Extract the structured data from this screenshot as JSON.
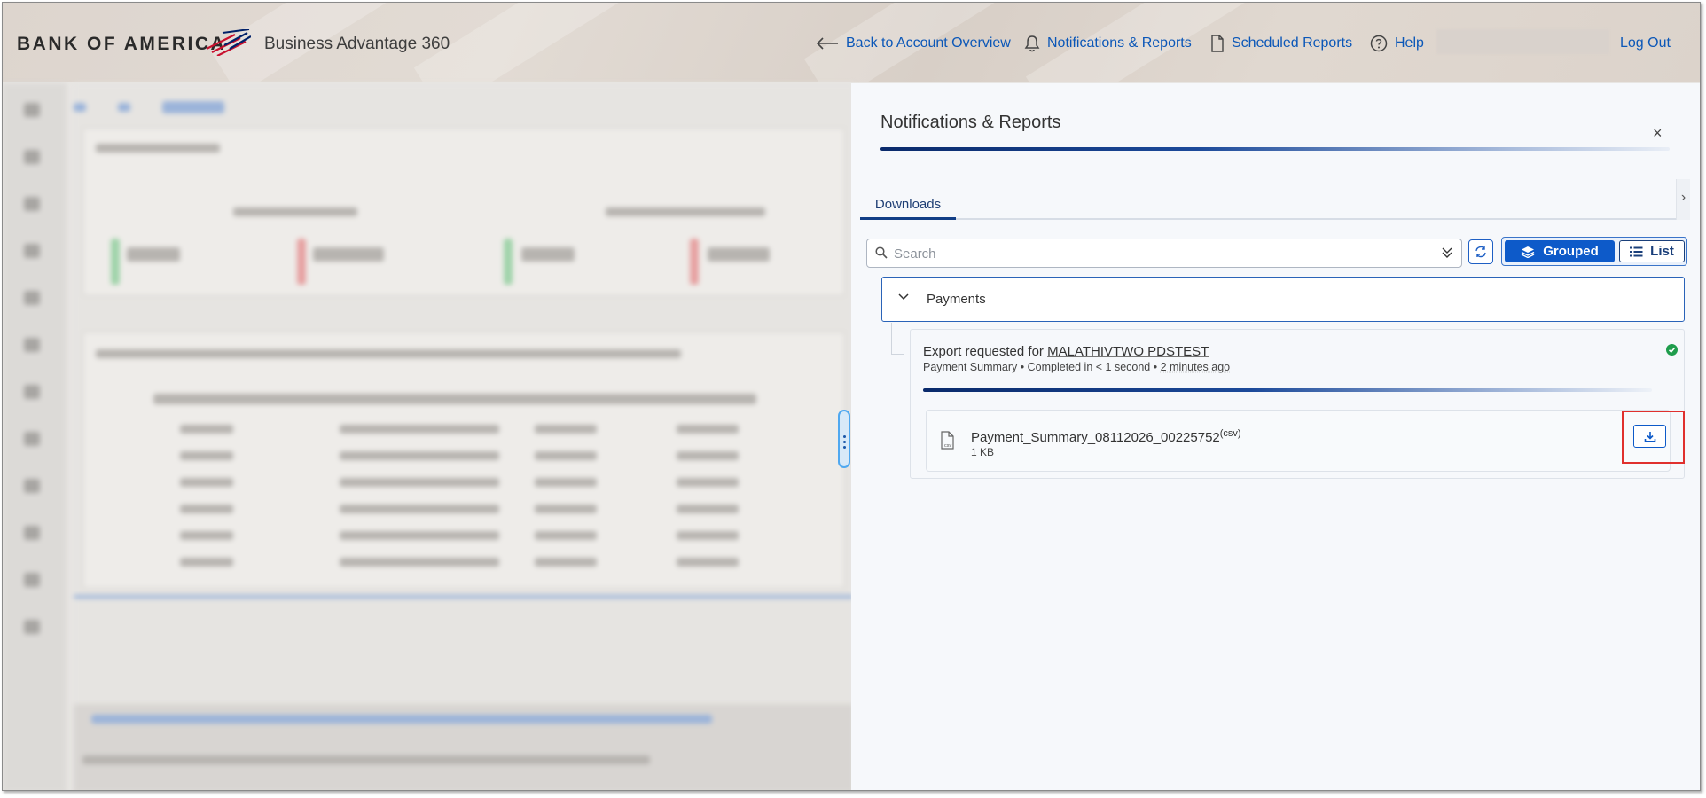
{
  "header": {
    "logo_text": "BANK OF AMERICA",
    "product_name": "Business Advantage 360",
    "nav": {
      "back": "Back to Account Overview",
      "notifications": "Notifications & Reports",
      "scheduled": "Scheduled Reports",
      "help": "Help",
      "logout": "Log Out"
    }
  },
  "drawer": {
    "title": "Notifications & Reports",
    "close_label": "×",
    "tabs": [
      {
        "label": "Downloads",
        "active": true
      }
    ],
    "search": {
      "placeholder": "Search"
    },
    "view_toggle": {
      "grouped": "Grouped",
      "list": "List",
      "selected": "Grouped"
    },
    "group": {
      "label": "Payments",
      "request": {
        "title_prefix": "Export requested for",
        "requested_for": "MALATHIVTWO PDSTEST",
        "report_type": "Payment Summary",
        "completed": "Completed in < 1 second",
        "time_ago": "2 minutes ago",
        "status": "complete",
        "file": {
          "name": "Payment_Summary_08112026_00225752",
          "extension": "(csv)",
          "size": "1 KB",
          "icon": "csv-file-icon"
        }
      }
    }
  },
  "colors": {
    "accent": "#0d5ac9",
    "link": "#0b57b8",
    "success": "#1f9d4c",
    "highlight": "#e0302d"
  }
}
